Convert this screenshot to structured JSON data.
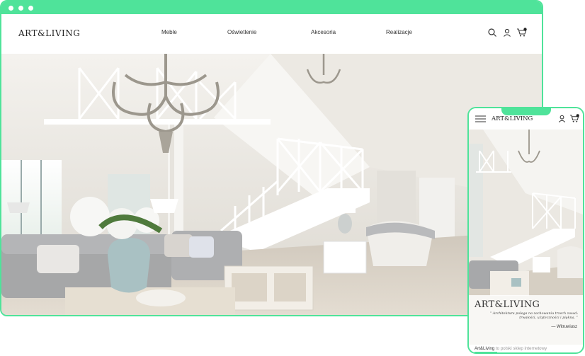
{
  "desktop": {
    "logo": "ART&LIVING",
    "menu": [
      "Meble",
      "Oświetlenie",
      "Akcesoria",
      "Realizacje"
    ],
    "icons": [
      "search-icon",
      "user-icon",
      "cart-icon"
    ]
  },
  "mobile": {
    "logo": "ART&LIVING",
    "hero_brand": "ART&LIVING",
    "quote": "“ Architektura polega na zachowaniu trzech zasad: trwałości, użyteczności i piękna. ”",
    "author": "— Witruwiusz",
    "footer": {
      "brand": "Art&Living",
      "rest": "to polski sklep internetowy"
    }
  },
  "colors": {
    "frame": "#4fe39a"
  }
}
